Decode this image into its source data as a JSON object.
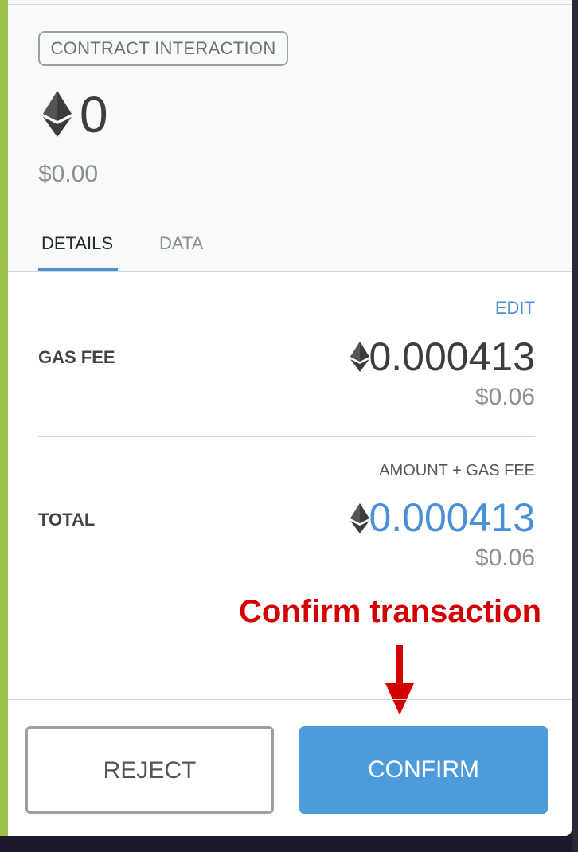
{
  "header": {
    "badge": "CONTRACT INTERACTION",
    "amount": "0",
    "fiat": "$0.00",
    "tabs": [
      "DETAILS",
      "DATA"
    ],
    "active_tab": "DETAILS"
  },
  "details": {
    "edit_label": "EDIT",
    "gas_fee": {
      "label": "GAS FEE",
      "eth": "0.000413",
      "fiat": "$0.06"
    },
    "total": {
      "caption": "AMOUNT + GAS FEE",
      "label": "TOTAL",
      "eth": "0.000413",
      "fiat": "$0.06"
    }
  },
  "annotation": {
    "text": "Confirm transaction",
    "color": "#d40000"
  },
  "footer": {
    "reject_label": "REJECT",
    "confirm_label": "CONFIRM"
  },
  "colors": {
    "accent": "#4a90d9",
    "confirm_bg": "#4e9bdc",
    "sidebar_green": "#9bc24b"
  },
  "icons": {
    "eth": "ethereum-diamond",
    "arrow": "down-arrow"
  }
}
